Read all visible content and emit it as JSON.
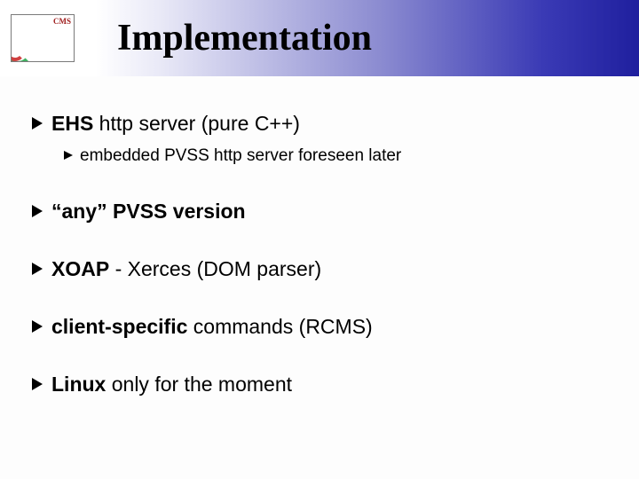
{
  "logo_label": "CMS",
  "title": "Implementation",
  "bullets": [
    {
      "level": 1,
      "segments": [
        {
          "text": "EHS",
          "bold": true
        },
        {
          "text": " http server (pure C++)",
          "bold": false
        }
      ],
      "children": [
        {
          "level": 2,
          "segments": [
            {
              "text": "embedded PVSS http server foreseen later",
              "bold": false
            }
          ]
        }
      ]
    },
    {
      "level": 1,
      "segments": [
        {
          "text": "“any” PVSS version",
          "bold": true
        }
      ]
    },
    {
      "level": 1,
      "segments": [
        {
          "text": "XOAP",
          "bold": true
        },
        {
          "text": " - Xerces (DOM parser)",
          "bold": false
        }
      ]
    },
    {
      "level": 1,
      "segments": [
        {
          "text": "client-specific",
          "bold": true
        },
        {
          "text": " commands (RCMS)",
          "bold": false
        }
      ]
    },
    {
      "level": 1,
      "segments": [
        {
          "text": "Linux",
          "bold": true
        },
        {
          "text": " only for the moment",
          "bold": false
        }
      ]
    }
  ]
}
